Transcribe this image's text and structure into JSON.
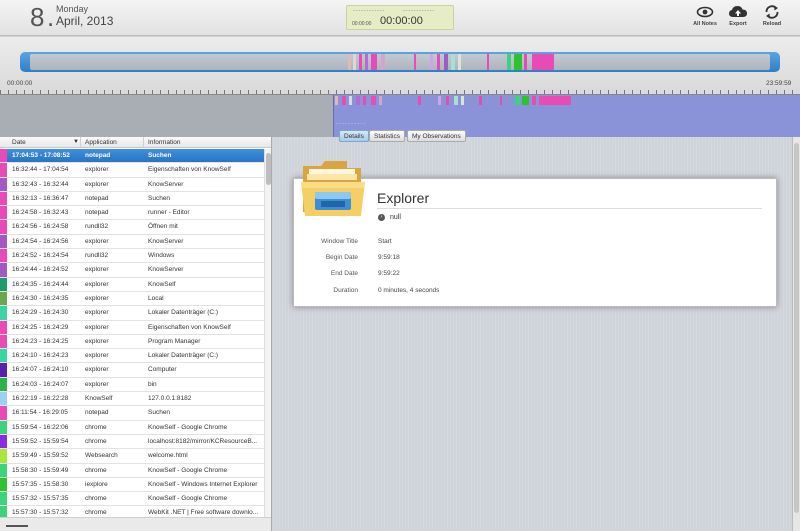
{
  "header": {
    "day_number": "8",
    "dot": ".",
    "weekday": "Monday",
    "date": "April, 2013",
    "timer_dashes_left": "- - - - - - - - - - - -",
    "timer_dashes_right": "- - - - - - - - - - - -",
    "timer_small": "00:00:00",
    "timer_big": "00:00:00",
    "tools": [
      {
        "label": "All Notes",
        "icon": "eye-icon"
      },
      {
        "label": "Export",
        "icon": "cloud-upload-icon"
      },
      {
        "label": "Reload",
        "icon": "reload-icon"
      }
    ]
  },
  "timeline": {
    "start": "00:00:00",
    "end": "23:59:59",
    "mini_label": "- - - - - - - - - -"
  },
  "list": {
    "headers": {
      "date": "Date",
      "application": "Application",
      "information": "Information"
    },
    "sort_arrow": "▼",
    "rows": [
      {
        "date": "17:04:53 - 17:08:52",
        "app": "notepad",
        "info": "Suchen",
        "color": "#e84bb6",
        "selected": true
      },
      {
        "date": "16:32:44 - 17:04:54",
        "app": "explorer",
        "info": "Eigenschaften von KnowSelf",
        "color": "#e84bb6"
      },
      {
        "date": "16:32:43 - 16:32:44",
        "app": "explorer",
        "info": "KnowServer",
        "color": "#a259c4"
      },
      {
        "date": "16:32:13 - 16:36:47",
        "app": "notepad",
        "info": "Suchen",
        "color": "#e84bb6"
      },
      {
        "date": "16:24:58 - 16:32:43",
        "app": "notepad",
        "info": "runner - Editor",
        "color": "#e84bb6"
      },
      {
        "date": "16:24:56 - 16:24:58",
        "app": "rundll32",
        "info": "Öffnen mit",
        "color": "#e84bb6"
      },
      {
        "date": "16:24:54 - 16:24:56",
        "app": "explorer",
        "info": "KnowServer",
        "color": "#a259c4"
      },
      {
        "date": "16:24:52 - 16:24:54",
        "app": "rundll32",
        "info": "Windows",
        "color": "#e84bb6"
      },
      {
        "date": "16:24:44 - 16:24:52",
        "app": "explorer",
        "info": "KnowServer",
        "color": "#a259c4"
      },
      {
        "date": "16:24:35 - 16:24:44",
        "app": "explorer",
        "info": "KnowSelf",
        "color": "#1f9a6a"
      },
      {
        "date": "16:24:30 - 16:24:35",
        "app": "explorer",
        "info": "Local",
        "color": "#6aa84f"
      },
      {
        "date": "16:24:29 - 16:24:30",
        "app": "explorer",
        "info": "Lokaler Datenträger (C:)",
        "color": "#3bd4a4"
      },
      {
        "date": "16:24:25 - 16:24:29",
        "app": "explorer",
        "info": "Eigenschaften von KnowSelf",
        "color": "#e84bb6"
      },
      {
        "date": "16:24:23 - 16:24:25",
        "app": "explorer",
        "info": "Program Manager",
        "color": "#e84bb6"
      },
      {
        "date": "16:24:10 - 16:24:23",
        "app": "explorer",
        "info": "Lokaler Datenträger (C:)",
        "color": "#3bd4a4"
      },
      {
        "date": "16:24:07 - 16:24:10",
        "app": "explorer",
        "info": "Computer",
        "color": "#5a1fb0"
      },
      {
        "date": "16:24:03 - 16:24:07",
        "app": "explorer",
        "info": "bin",
        "color": "#2db34a"
      },
      {
        "date": "16:22:19 - 16:22:28",
        "app": "KnowSelf",
        "info": "127.0.0.1:8182",
        "color": "#9ad0f5"
      },
      {
        "date": "16:11:54 - 16:29:05",
        "app": "notepad",
        "info": "Suchen",
        "color": "#e84bb6"
      },
      {
        "date": "15:59:54 - 16:22:06",
        "app": "chrome",
        "info": "KnowSelf - Google Chrome",
        "color": "#3bd47a"
      },
      {
        "date": "15:59:52 - 15:59:54",
        "app": "chrome",
        "info": "localhost:8182/mirror/KCResourceB...",
        "color": "#8a2be2"
      },
      {
        "date": "15:59:49 - 15:59:52",
        "app": "Websearch",
        "info": "welcome.html",
        "color": "#a8e63b"
      },
      {
        "date": "15:58:30 - 15:59:49",
        "app": "chrome",
        "info": "KnowSelf - Google Chrome",
        "color": "#3bd47a"
      },
      {
        "date": "15:57:35 - 15:58:30",
        "app": "iexplore",
        "info": "KnowSelf - Windows Internet Explorer",
        "color": "#2ec22e"
      },
      {
        "date": "15:57:32 - 15:57:35",
        "app": "chrome",
        "info": "KnowSelf - Google Chrome",
        "color": "#3bd47a"
      },
      {
        "date": "15:57:30 - 15:57:32",
        "app": "chrome",
        "info": "WebKit .NET | Free software downlo...",
        "color": "#3bd47a"
      }
    ]
  },
  "tabs": [
    "Details",
    "Statistics",
    "My Observations"
  ],
  "detail": {
    "title": "Explorer",
    "null_text": "null",
    "fields": [
      {
        "label": "Window Title",
        "value": "Start"
      },
      {
        "label": "Begin Date",
        "value": "9:59:18"
      },
      {
        "label": "End Date",
        "value": "9:59:22"
      },
      {
        "label": "Duration",
        "value": "0 minutes, 4 seconds"
      }
    ]
  },
  "colors": {
    "accent_blue": "#2a74c4",
    "slider_blue": "#3b8ed6",
    "mini_selection": "#8b93d8"
  }
}
